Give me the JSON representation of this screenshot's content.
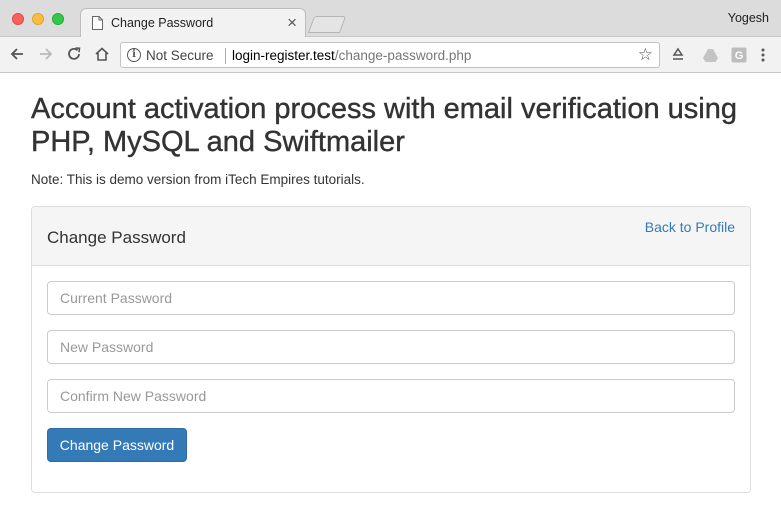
{
  "browser": {
    "tab_title": "Change Password",
    "tab_close": "×",
    "profile_name": "Yogesh",
    "security_label": "Not Secure",
    "url_host": "login-register.test",
    "url_path": "/change-password.php"
  },
  "page": {
    "heading": "Account activation process with email verification using PHP, MySQL and Swiftmailer",
    "note": "Note: This is demo version from iTech Empires tutorials."
  },
  "panel": {
    "title": "Change Password",
    "back_link": "Back to Profile",
    "current_placeholder": "Current Password",
    "new_placeholder": "New Password",
    "confirm_placeholder": "Confirm New Password",
    "submit_label": "Change Password"
  },
  "colors": {
    "primary": "#337ab7",
    "link": "#337ab7"
  }
}
